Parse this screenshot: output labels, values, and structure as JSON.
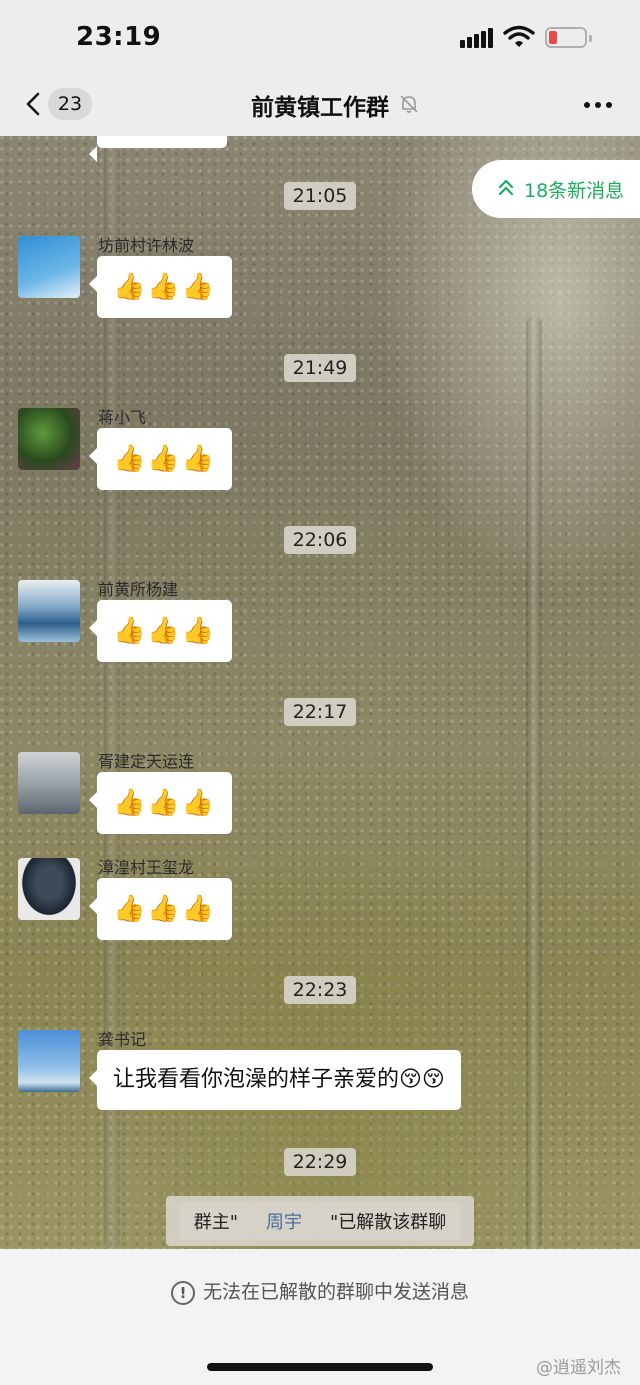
{
  "status_bar": {
    "time": "23:19"
  },
  "nav": {
    "back_count": "23",
    "title": "前黄镇工作群"
  },
  "new_messages": {
    "label": "18条新消息"
  },
  "thumbs": "👍👍👍",
  "timestamps": [
    "21:05",
    "21:49",
    "22:06",
    "22:17",
    "22:23",
    "22:29"
  ],
  "messages": [
    {
      "sender": "坊前村许林波"
    },
    {
      "sender": "蒋小飞"
    },
    {
      "sender": "前黄所杨建"
    },
    {
      "sender": "胥建定天运连"
    },
    {
      "sender": "漳湟村王玺龙"
    },
    {
      "sender": "龚书记",
      "text": "让我看看你泡澡的样子亲爱的😚😚"
    }
  ],
  "system_notice": {
    "prefix": "群主\"",
    "owner": "周宇",
    "suffix": "\"已解散该群聊"
  },
  "footer": {
    "notice": "无法在已解散的群聊中发送消息",
    "watermark": "@逍遥刘杰"
  },
  "colors": {
    "accent_green": "#1aad5c",
    "battery_low": "#e84a4a",
    "owner_link": "#4a6c9b"
  }
}
